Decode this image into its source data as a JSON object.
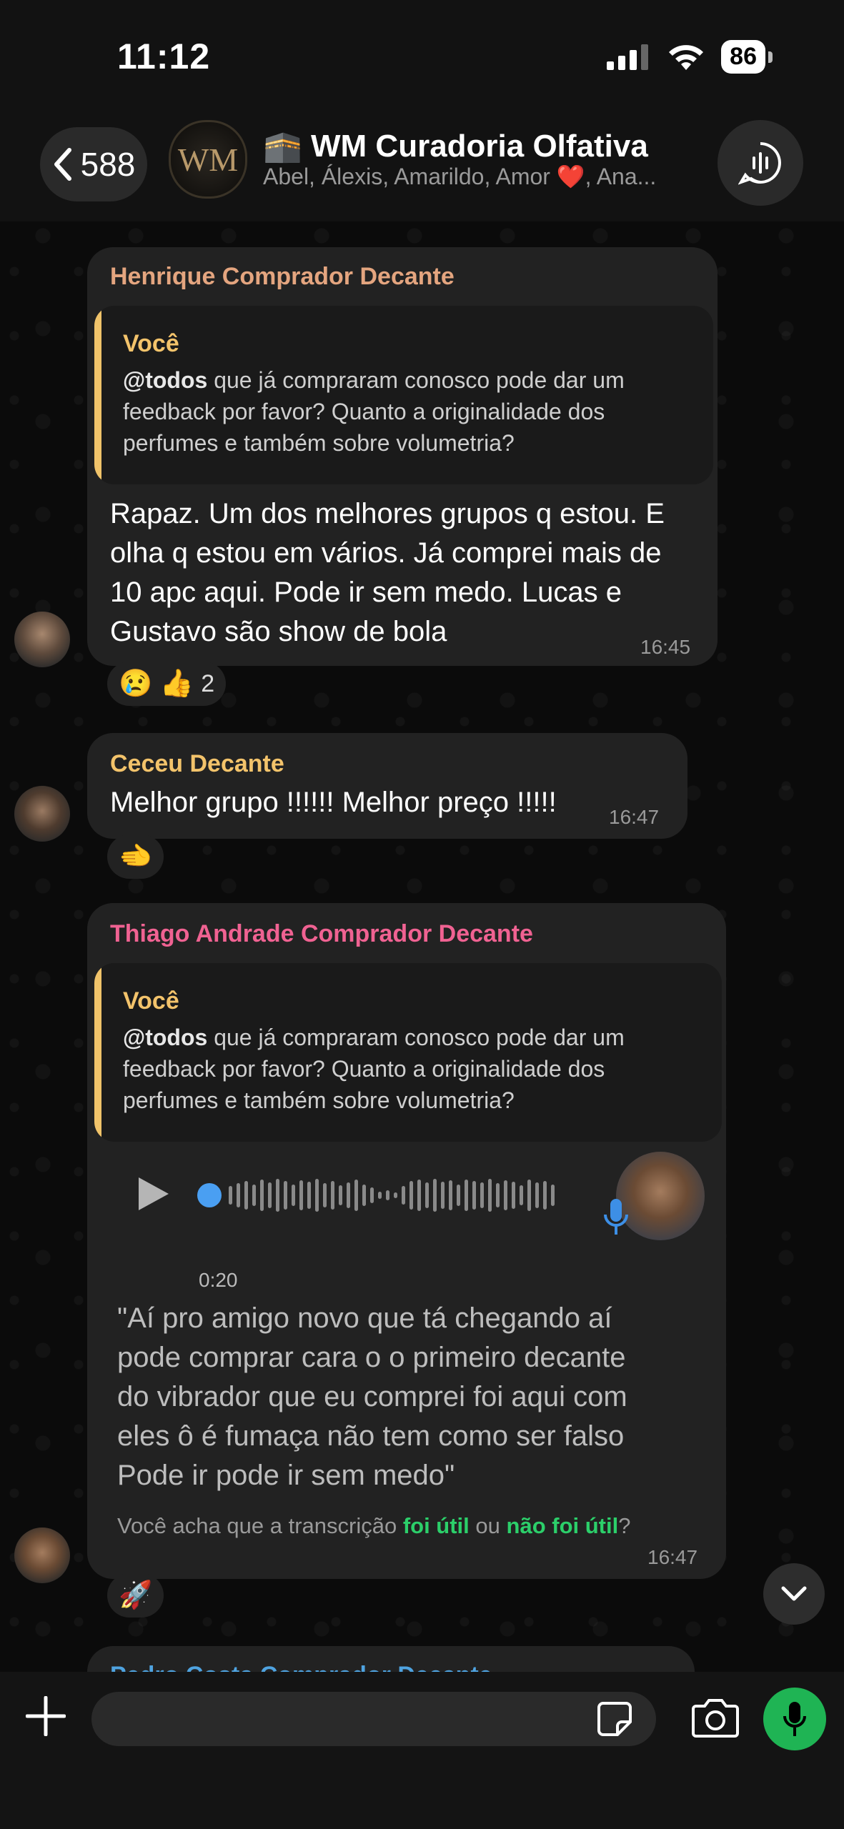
{
  "status_bar": {
    "time": "11:12",
    "battery": "86"
  },
  "header": {
    "back_count": "588",
    "avatar_monogram": "WM",
    "title": "🕋 WM Curadoria Olfativa",
    "members": "Abel, Álexis, Amarildo, Amor ❤️, Ana..."
  },
  "messages": [
    {
      "sender": "Henrique Comprador Decante",
      "sender_color": "#e4a57f",
      "quote_author": "Você",
      "quote_mention": "@todos",
      "quote_text": " que já compraram conosco pode dar um feedback por favor? Quanto a originalidade dos perfumes e também sobre volumetria?",
      "lines": [
        "Rapaz. Um dos melhores grupos q estou. E",
        "olha q estou em vários. Já comprei mais de",
        "10 apc aqui. Pode ir sem medo. Lucas e",
        "Gustavo são show de bola"
      ],
      "time": "16:45",
      "reactions": "😢 👍",
      "reaction_count": "2"
    },
    {
      "sender": "Ceceu Decante",
      "sender_color": "#f3c36b",
      "text": "Melhor grupo !!!!!! Melhor preço !!!!!",
      "time": "16:47",
      "reactions": "🫲"
    },
    {
      "sender": "Thiago Andrade Comprador Decante",
      "sender_color": "#f06292",
      "quote_author": "Você",
      "quote_mention": "@todos",
      "quote_text": " que já compraram conosco pode dar um feedback por favor? Quanto a originalidade dos perfumes e também sobre volumetria?",
      "audio_duration": "0:20",
      "transcription_lines": [
        "\"Aí pro amigo novo que tá chegando aí",
        "pode comprar cara o o primeiro decante",
        "do vibrador que eu comprei foi aqui com",
        "eles ô é fumaça não tem como ser falso",
        "Pode ir pode ir sem medo\""
      ],
      "feedback_prefix": "Você acha que a transcrição ",
      "feedback_yes": "foi útil",
      "feedback_or": " ou ",
      "feedback_no": "não foi útil",
      "feedback_suffix": "?",
      "time": "16:47",
      "reactions": "🚀"
    },
    {
      "sender": "Pedro Costa Comprador Decante",
      "sender_color": "#4fa3e0"
    }
  ],
  "colors": {
    "accent_green": "#1fb454",
    "quote_bar": "#f0c36a",
    "bubble": "#222222"
  }
}
